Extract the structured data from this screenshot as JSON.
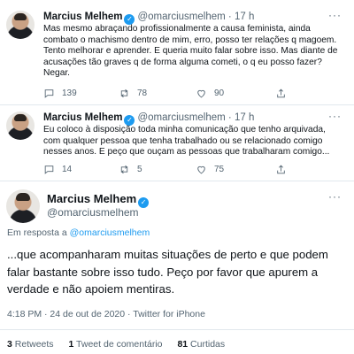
{
  "tweets": [
    {
      "name": "Marcius Melhem",
      "handle": "@omarciusmelhem",
      "dot": "·",
      "time": "17 h",
      "text": "Mas mesmo abraçando profissionalmente a causa feminista, ainda combato o machismo dentro de mim, erro, posso ter relações q magoem. Tento melhorar e aprender. E queria muito falar sobre isso. Mas diante de acusações tão graves q de forma alguma cometi, o q eu posso fazer? Negar.",
      "replies": "139",
      "retweets": "78",
      "likes": "90"
    },
    {
      "name": "Marcius Melhem",
      "handle": "@omarciusmelhem",
      "dot": "·",
      "time": "17 h",
      "text": "Eu coloco à disposição toda minha comunicação que tenho arquivada, com qualquer pessoa que tenha trabalhado ou se relacionado comigo nesses anos. E peço que ouçam as pessoas que trabalharam comigo...",
      "replies": "14",
      "retweets": "5",
      "likes": "75"
    }
  ],
  "main": {
    "name": "Marcius Melhem",
    "handle": "@omarciusmelhem",
    "reply_prefix": "Em resposta a",
    "reply_handle": "@omarciusmelhem",
    "text": "...que acompanharam muitas situações de perto e que podem falar bastante sobre isso tudo. Peço por favor que apurem a verdade e não apoiem mentiras.",
    "timestamp": "4:18 PM · 24 de out de 2020 · ",
    "source": "Twitter for iPhone",
    "retweets_count": "3",
    "retweets_label": "Retweets",
    "comments_count": "1",
    "comments_label": "Tweet de comentário",
    "likes_count": "81",
    "likes_label": "Curtidas"
  },
  "icons": {
    "verified": "verified-badge-icon",
    "more": "more-icon",
    "reply": "reply-icon",
    "retweet": "retweet-icon",
    "like": "heart-icon",
    "share": "share-icon"
  },
  "colors": {
    "accent": "#1d9bf0",
    "text": "#0f1419",
    "muted": "#536471",
    "separator": "#e1e8ed"
  }
}
